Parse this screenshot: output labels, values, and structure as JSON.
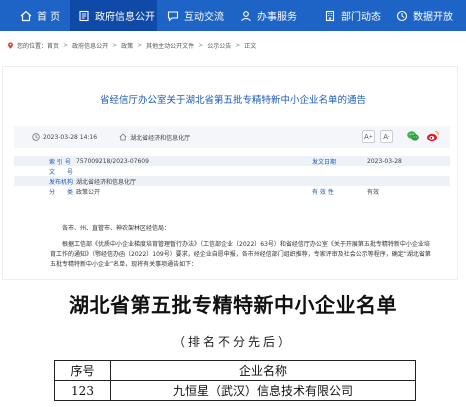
{
  "nav": {
    "items": [
      {
        "label": "首 页",
        "icon": "home-icon"
      },
      {
        "label": "政府信息公开",
        "icon": "document-icon",
        "active": true
      },
      {
        "label": "互动交流",
        "icon": "chat-icon"
      },
      {
        "label": "办事服务",
        "icon": "user-icon"
      },
      {
        "label": "部门动态",
        "icon": "building-icon"
      },
      {
        "label": "数据开放",
        "icon": "data-icon"
      }
    ],
    "color": "#1d64c6",
    "active_color": "#0f4aa8"
  },
  "breadcrumb": {
    "prefix": "您的位置：",
    "items": [
      "首页",
      "政府信息公开",
      "政策",
      "其他主动公开文件",
      "公示公告",
      "正文"
    ]
  },
  "article": {
    "title": "省经信厅办公室关于湖北省第五批专精特新中小企业名单的通告",
    "date": "2023-03-28 14:16",
    "source": "湖北省经济和信息化厅",
    "font_large": "A",
    "font_small": "A",
    "share": [
      "wechat-icon",
      "weibo-icon"
    ]
  },
  "info_table": {
    "rows": [
      {
        "label": "索 引 号",
        "value": "757009218/2023-07609",
        "label2": "发文日期",
        "value2": "2023-03-28"
      },
      {
        "label": "文　　号",
        "value": "",
        "label2": "",
        "value2": ""
      },
      {
        "label": "发布机构",
        "value": "湖北省经济和信息化厅",
        "label2": "",
        "value2": ""
      },
      {
        "label": "分　　类",
        "value": "政策公开",
        "label2": "有 效 性",
        "value2": "有效"
      }
    ]
  },
  "body": {
    "salutation": "各市、州、直管市、神农架林区经信局：",
    "paragraph": "根据工信部《优质中小企业梯度培育管理暂行办法》（工信部企业〔2022〕63号）和省经信厅办公室《关于开展第五批专精特新中小企业培育工作的通知》（鄂经信办函〔2022〕109号）要求，经企业自愿申报，各市州经信部门组织推荐，专家评审及社会公示等程序，确定“湖北省第五批专精特新中小企业”名单，现将有关事项通告如下："
  },
  "list_image": {
    "title": "湖北省第五批专精特新中小企业名单",
    "subtitle": "（排名不分先后）",
    "header": {
      "col1": "序号",
      "col2": "企业名称"
    },
    "rows": [
      {
        "no": "123",
        "name": "九恒星（武汉）信息技术有限公司"
      }
    ]
  }
}
